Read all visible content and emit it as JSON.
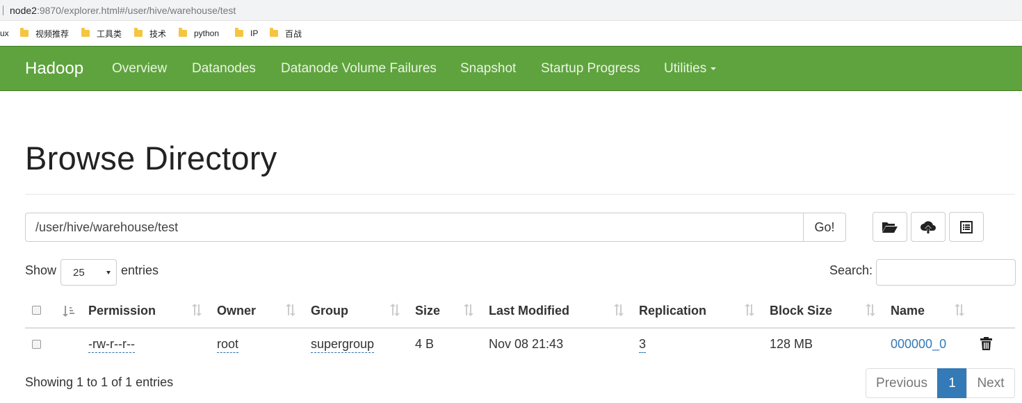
{
  "browser": {
    "url_host": "node2",
    "url_rest": ":9870/explorer.html#/user/hive/warehouse/test",
    "bookmarks": [
      {
        "label": "ux"
      },
      {
        "label": "视频推荐"
      },
      {
        "label": "工具类"
      },
      {
        "label": "技术"
      },
      {
        "label": "python"
      },
      {
        "label": "IP"
      },
      {
        "label": "百战"
      }
    ]
  },
  "navbar": {
    "brand": "Hadoop",
    "items": [
      {
        "label": "Overview"
      },
      {
        "label": "Datanodes"
      },
      {
        "label": "Datanode Volume Failures"
      },
      {
        "label": "Snapshot"
      },
      {
        "label": "Startup Progress"
      },
      {
        "label": "Utilities"
      }
    ],
    "color": "#5fa33e"
  },
  "page": {
    "title": "Browse Directory",
    "path_value": "/user/hive/warehouse/test",
    "go_label": "Go!",
    "toolbar_icons": [
      "folder-open-icon",
      "cloud-upload-icon",
      "list-alt-icon"
    ]
  },
  "table_controls": {
    "show_label": "Show",
    "entries_value": "25",
    "entries_label": "entries",
    "search_label": "Search:"
  },
  "table": {
    "columns": [
      "Permission",
      "Owner",
      "Group",
      "Size",
      "Last Modified",
      "Replication",
      "Block Size",
      "Name"
    ],
    "rows": [
      {
        "permission": "-rw-r--r--",
        "owner": "root",
        "group": "supergroup",
        "size": "4 B",
        "last_modified": "Nov 08 21:43",
        "replication": "3",
        "block_size": "128 MB",
        "name": "000000_0"
      }
    ]
  },
  "footer": {
    "showing": "Showing 1 to 1 of 1 entries",
    "previous": "Previous",
    "page": "1",
    "next": "Next",
    "accent": "#337ab7"
  }
}
